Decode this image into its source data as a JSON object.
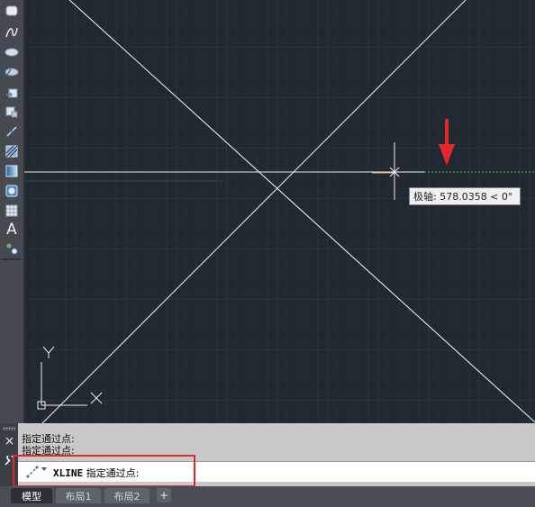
{
  "canvas": {
    "tooltip_text": "极轴: 578.0358 < 0°",
    "ucs_y_label": "Y",
    "ucs_x_label": "X"
  },
  "toolbar": {
    "icons": [
      "rectangle-icon",
      "spline-icon",
      "ellipse-icon",
      "ellipse-arc-icon",
      "insert-block-icon",
      "make-block-icon",
      "point-icon",
      "hatch-icon",
      "gradient-icon",
      "region-icon",
      "table-icon",
      "multiline-text-icon",
      "add-selected-icon"
    ],
    "text_tool_label": "A"
  },
  "command_window": {
    "history": [
      "指定通过点:",
      "指定通过点:"
    ],
    "prompt_command": "XLINE",
    "prompt_text": "指定通过点:",
    "close_label": "×"
  },
  "tabs": {
    "items": [
      "模型",
      "布局1",
      "布局2"
    ],
    "active_index": 0,
    "add_label": "+"
  },
  "colors": {
    "canvas_bg": "#212830",
    "annotation_red": "#e0282d",
    "tracking_green": "#3cd26e"
  }
}
